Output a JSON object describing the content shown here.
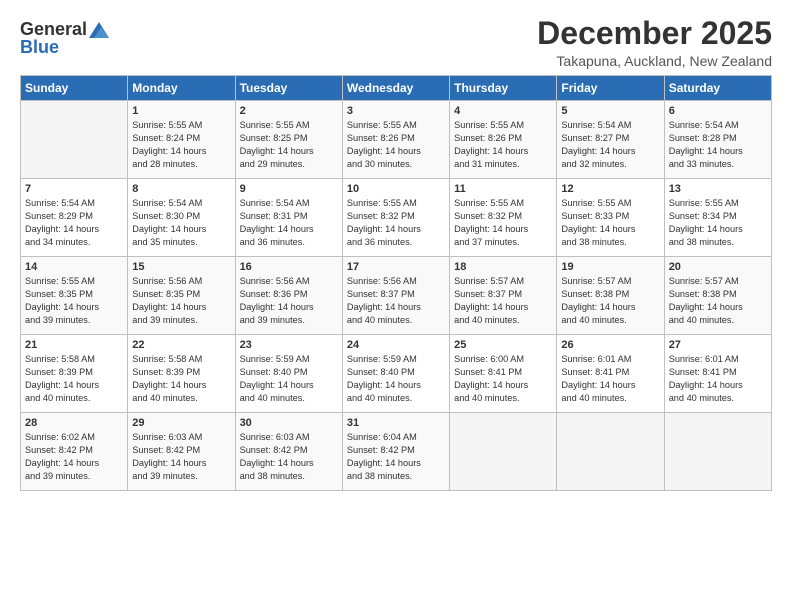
{
  "header": {
    "logo_general": "General",
    "logo_blue": "Blue",
    "month": "December 2025",
    "location": "Takapuna, Auckland, New Zealand"
  },
  "weekdays": [
    "Sunday",
    "Monday",
    "Tuesday",
    "Wednesday",
    "Thursday",
    "Friday",
    "Saturday"
  ],
  "weeks": [
    [
      {
        "day": "",
        "info": ""
      },
      {
        "day": "1",
        "info": "Sunrise: 5:55 AM\nSunset: 8:24 PM\nDaylight: 14 hours\nand 28 minutes."
      },
      {
        "day": "2",
        "info": "Sunrise: 5:55 AM\nSunset: 8:25 PM\nDaylight: 14 hours\nand 29 minutes."
      },
      {
        "day": "3",
        "info": "Sunrise: 5:55 AM\nSunset: 8:26 PM\nDaylight: 14 hours\nand 30 minutes."
      },
      {
        "day": "4",
        "info": "Sunrise: 5:55 AM\nSunset: 8:26 PM\nDaylight: 14 hours\nand 31 minutes."
      },
      {
        "day": "5",
        "info": "Sunrise: 5:54 AM\nSunset: 8:27 PM\nDaylight: 14 hours\nand 32 minutes."
      },
      {
        "day": "6",
        "info": "Sunrise: 5:54 AM\nSunset: 8:28 PM\nDaylight: 14 hours\nand 33 minutes."
      }
    ],
    [
      {
        "day": "7",
        "info": "Sunrise: 5:54 AM\nSunset: 8:29 PM\nDaylight: 14 hours\nand 34 minutes."
      },
      {
        "day": "8",
        "info": "Sunrise: 5:54 AM\nSunset: 8:30 PM\nDaylight: 14 hours\nand 35 minutes."
      },
      {
        "day": "9",
        "info": "Sunrise: 5:54 AM\nSunset: 8:31 PM\nDaylight: 14 hours\nand 36 minutes."
      },
      {
        "day": "10",
        "info": "Sunrise: 5:55 AM\nSunset: 8:32 PM\nDaylight: 14 hours\nand 36 minutes."
      },
      {
        "day": "11",
        "info": "Sunrise: 5:55 AM\nSunset: 8:32 PM\nDaylight: 14 hours\nand 37 minutes."
      },
      {
        "day": "12",
        "info": "Sunrise: 5:55 AM\nSunset: 8:33 PM\nDaylight: 14 hours\nand 38 minutes."
      },
      {
        "day": "13",
        "info": "Sunrise: 5:55 AM\nSunset: 8:34 PM\nDaylight: 14 hours\nand 38 minutes."
      }
    ],
    [
      {
        "day": "14",
        "info": "Sunrise: 5:55 AM\nSunset: 8:35 PM\nDaylight: 14 hours\nand 39 minutes."
      },
      {
        "day": "15",
        "info": "Sunrise: 5:56 AM\nSunset: 8:35 PM\nDaylight: 14 hours\nand 39 minutes."
      },
      {
        "day": "16",
        "info": "Sunrise: 5:56 AM\nSunset: 8:36 PM\nDaylight: 14 hours\nand 39 minutes."
      },
      {
        "day": "17",
        "info": "Sunrise: 5:56 AM\nSunset: 8:37 PM\nDaylight: 14 hours\nand 40 minutes."
      },
      {
        "day": "18",
        "info": "Sunrise: 5:57 AM\nSunset: 8:37 PM\nDaylight: 14 hours\nand 40 minutes."
      },
      {
        "day": "19",
        "info": "Sunrise: 5:57 AM\nSunset: 8:38 PM\nDaylight: 14 hours\nand 40 minutes."
      },
      {
        "day": "20",
        "info": "Sunrise: 5:57 AM\nSunset: 8:38 PM\nDaylight: 14 hours\nand 40 minutes."
      }
    ],
    [
      {
        "day": "21",
        "info": "Sunrise: 5:58 AM\nSunset: 8:39 PM\nDaylight: 14 hours\nand 40 minutes."
      },
      {
        "day": "22",
        "info": "Sunrise: 5:58 AM\nSunset: 8:39 PM\nDaylight: 14 hours\nand 40 minutes."
      },
      {
        "day": "23",
        "info": "Sunrise: 5:59 AM\nSunset: 8:40 PM\nDaylight: 14 hours\nand 40 minutes."
      },
      {
        "day": "24",
        "info": "Sunrise: 5:59 AM\nSunset: 8:40 PM\nDaylight: 14 hours\nand 40 minutes."
      },
      {
        "day": "25",
        "info": "Sunrise: 6:00 AM\nSunset: 8:41 PM\nDaylight: 14 hours\nand 40 minutes."
      },
      {
        "day": "26",
        "info": "Sunrise: 6:01 AM\nSunset: 8:41 PM\nDaylight: 14 hours\nand 40 minutes."
      },
      {
        "day": "27",
        "info": "Sunrise: 6:01 AM\nSunset: 8:41 PM\nDaylight: 14 hours\nand 40 minutes."
      }
    ],
    [
      {
        "day": "28",
        "info": "Sunrise: 6:02 AM\nSunset: 8:42 PM\nDaylight: 14 hours\nand 39 minutes."
      },
      {
        "day": "29",
        "info": "Sunrise: 6:03 AM\nSunset: 8:42 PM\nDaylight: 14 hours\nand 39 minutes."
      },
      {
        "day": "30",
        "info": "Sunrise: 6:03 AM\nSunset: 8:42 PM\nDaylight: 14 hours\nand 38 minutes."
      },
      {
        "day": "31",
        "info": "Sunrise: 6:04 AM\nSunset: 8:42 PM\nDaylight: 14 hours\nand 38 minutes."
      },
      {
        "day": "",
        "info": ""
      },
      {
        "day": "",
        "info": ""
      },
      {
        "day": "",
        "info": ""
      }
    ]
  ]
}
